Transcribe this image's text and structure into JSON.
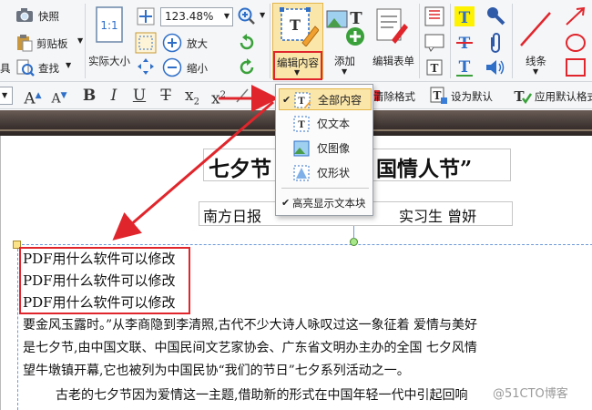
{
  "ribbon": {
    "quick_open": "快照",
    "clipboard": "剪贴板",
    "tool_partial": "具",
    "find": "查找",
    "actual_size": "实际大小",
    "zoom_value": "123.48%",
    "zoom_in": "放大",
    "zoom_out": "缩小",
    "edit_content": "编辑内容",
    "add": "添加",
    "edit_form": "编辑表单",
    "lines": "线条"
  },
  "format_bar": {
    "clear_format": "清除格式",
    "set_default": "设为默认",
    "apply_default": "应用默认格式"
  },
  "menu": {
    "items": [
      "全部内容",
      "仅文本",
      "仅图像",
      "仅形状"
    ],
    "highlight_blocks": "高亮显示文本块"
  },
  "document": {
    "title_left": "七夕节",
    "title_right": "国情人节”",
    "subtitle_left": "南方日报",
    "subtitle_right": "实习生   曾妍",
    "inserted_lines": [
      "PDF用什么软件可以修改",
      "PDF用什么软件可以修改",
      "PDF用什么软件可以修改"
    ],
    "para1": "要金风玉露时。”从李商隐到李清照,古代不少大诗人咏叹过这一象征着 爱情与美好",
    "para2": "是七夕节,由中国文联、中国民间文艺家协会、广东省文明办主办的全国   七夕风情",
    "para3": "望牛墩镇开幕,它也被列为中国民协“我们的节日”七夕系列活动之一。",
    "para4": "古老的七夕节因为爱情这一主题,借助新的形式在中国年轻一代中引起回响"
  },
  "watermark": "@51CTO博客",
  "colors": {
    "highlight_red": "#e0262c",
    "menu_selected": "#fbe6a9",
    "accent_blue": "#2f6fc8"
  }
}
